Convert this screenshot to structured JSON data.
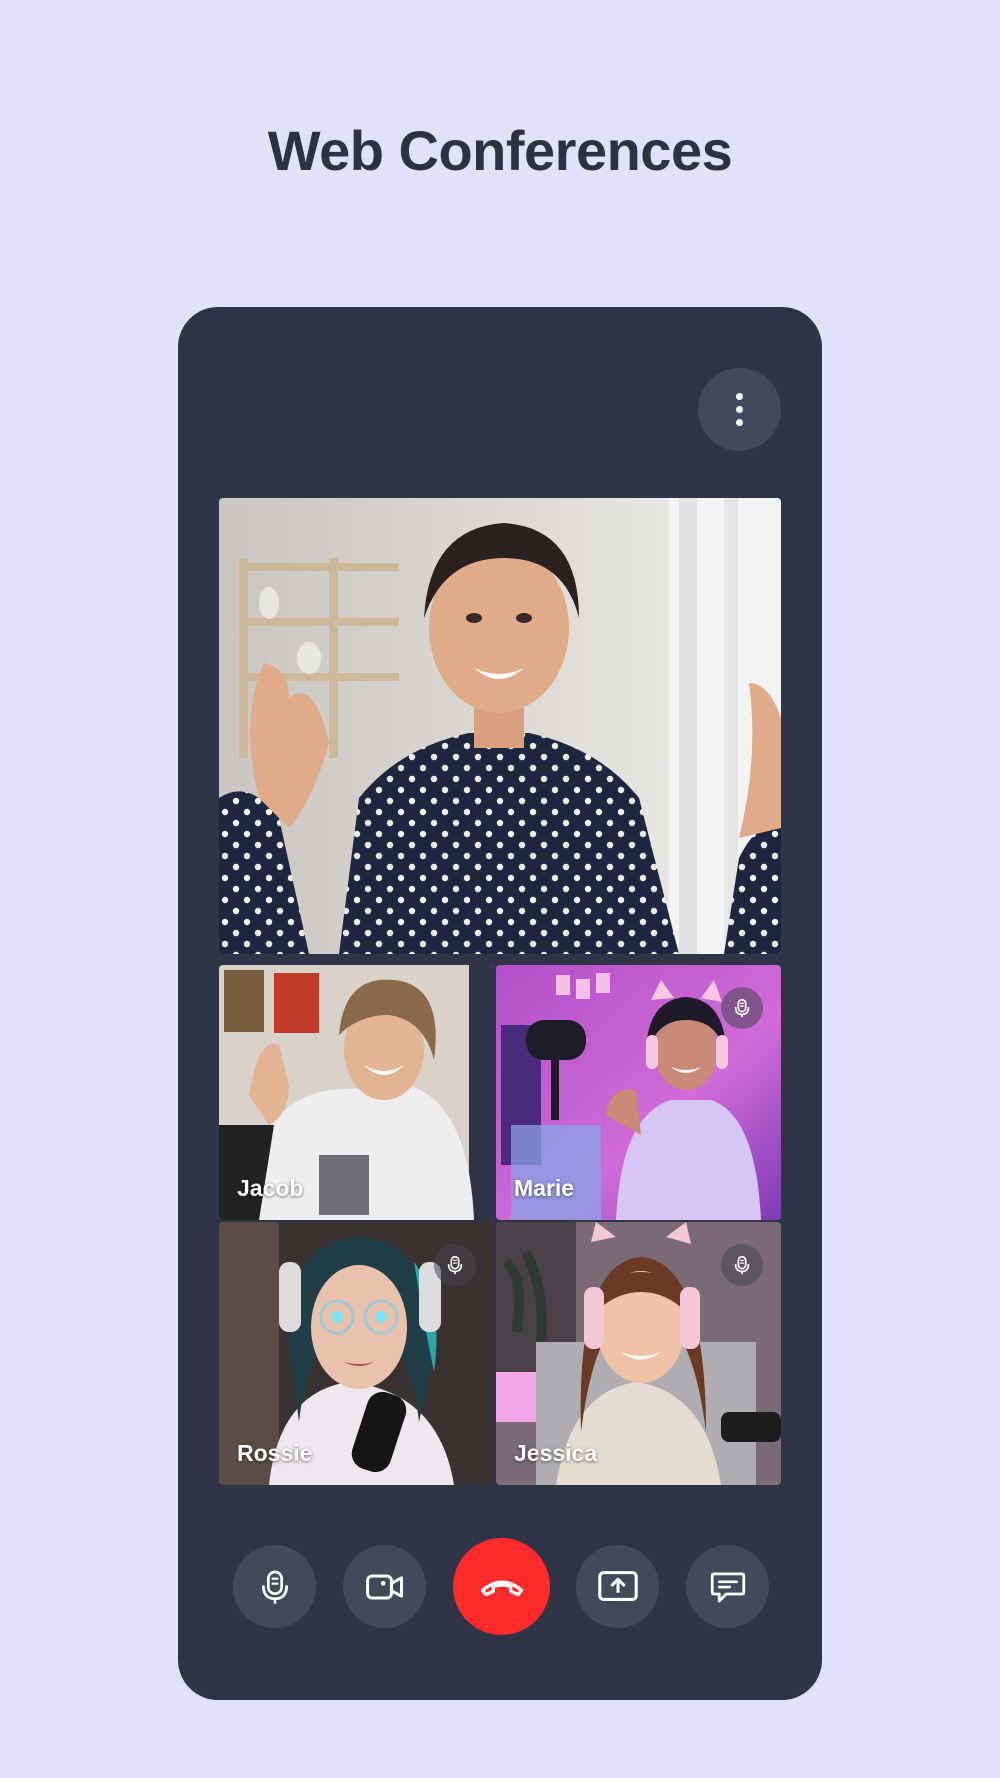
{
  "page": {
    "title": "Web Conferences"
  },
  "call": {
    "more_icon": "more-vertical-icon",
    "main_participant": {
      "name": ""
    },
    "participants": [
      {
        "name": "Jacob",
        "muted_badge": false
      },
      {
        "name": "Marie",
        "muted_badge": true
      },
      {
        "name": "Rossie",
        "muted_badge": true
      },
      {
        "name": "Jessica",
        "muted_badge": true
      }
    ],
    "controls": [
      {
        "id": "microphone",
        "icon": "microphone-icon"
      },
      {
        "id": "camera",
        "icon": "video-camera-icon"
      },
      {
        "id": "end-call",
        "icon": "phone-hangup-icon"
      },
      {
        "id": "share-screen",
        "icon": "screen-share-icon"
      },
      {
        "id": "chat",
        "icon": "chat-bubble-icon"
      }
    ]
  },
  "colors": {
    "background": "#e3e0fd",
    "panel": "#303447",
    "button": "#44485a",
    "end_call": "#ff2b2b",
    "title": "#2e3142"
  }
}
